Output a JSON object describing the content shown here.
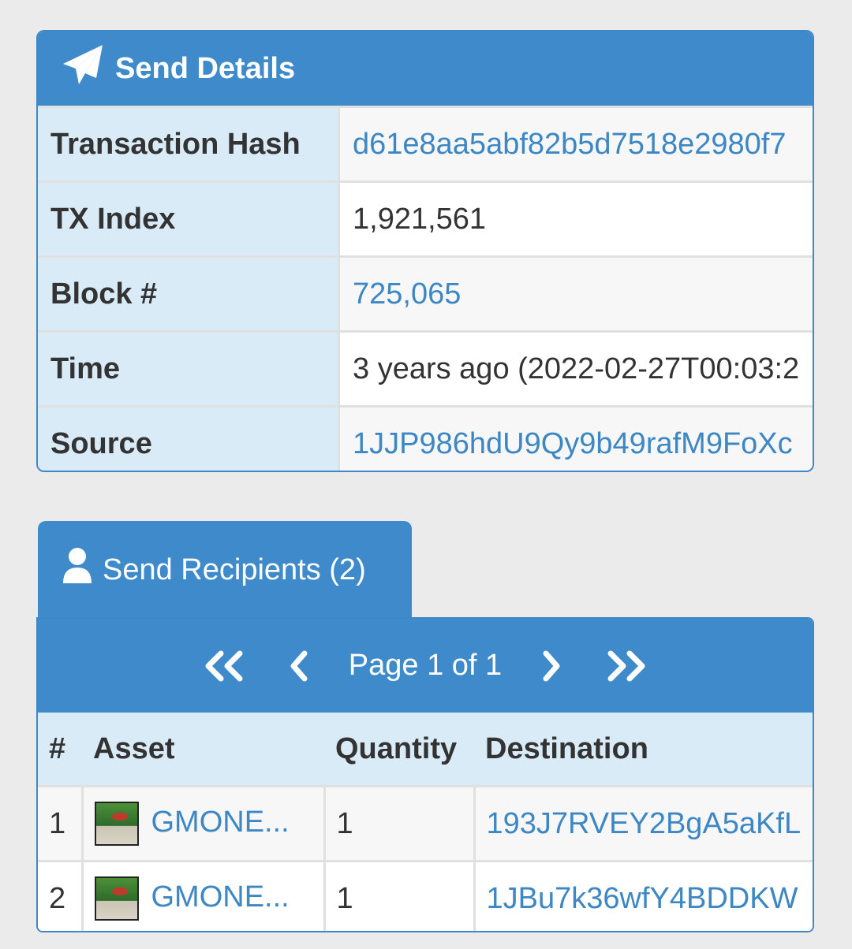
{
  "details": {
    "title": "Send Details",
    "rows": [
      {
        "label": "Transaction Hash",
        "value": "d61e8aa5abf82b5d7518e2980f7"
      },
      {
        "label": "TX Index",
        "value": "1,921,561"
      },
      {
        "label": "Block #",
        "value": "725,065"
      },
      {
        "label": "Time",
        "value": "3 years ago (2022-02-27T00:03:2"
      },
      {
        "label": "Source",
        "value": "1JJP986hdU9Qy9b49rafM9FoXc"
      }
    ]
  },
  "recipients": {
    "tab_label": "Send Recipients (2)",
    "pager": {
      "first": "«",
      "prev": "‹",
      "page_text": "Page 1 of 1",
      "next": "›",
      "last": "»"
    },
    "columns": [
      "#",
      "Asset",
      "Quantity",
      "Destination"
    ],
    "rows": [
      {
        "index": "1",
        "asset": "GMONE...",
        "quantity": "1",
        "destination": "193J7RVEY2BgA5aKfL"
      },
      {
        "index": "2",
        "asset": "GMONE...",
        "quantity": "1",
        "destination": "1JBu7k36wfY4BDDKW"
      }
    ]
  },
  "colors": {
    "header_blue": "#3f8acb",
    "label_bg": "#d9ebf7",
    "link": "#3d87c4"
  }
}
